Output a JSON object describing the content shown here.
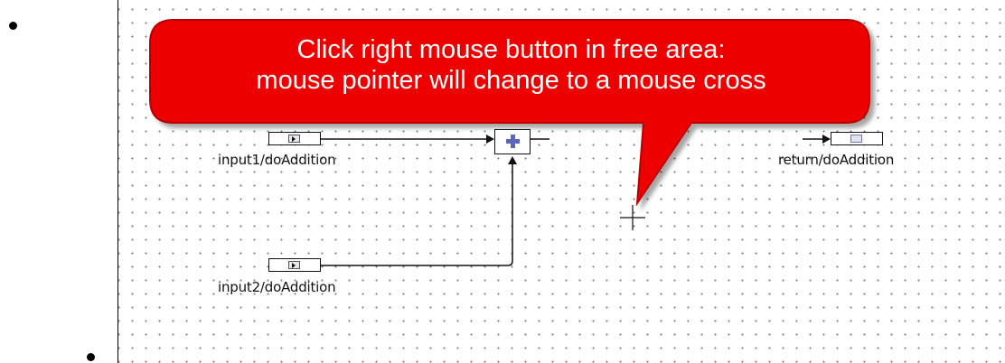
{
  "diagram": {
    "nodes": {
      "input1_label": "input1/doAddition",
      "input2_label": "input2/doAddition",
      "return_label": "return/doAddition"
    },
    "callout": {
      "text": "Click right mouse button in free area:\nmouse pointer will change to a mouse cross"
    },
    "colors": {
      "callout_fill": "#ee0000",
      "callout_border": "#b80000",
      "add_symbol": "#5a66b8",
      "grid_dot": "#7a7a7a"
    },
    "icons": [
      "input-port-arrow-icon",
      "add-operator-icon",
      "output-port-icon",
      "crosshair-cursor-icon"
    ]
  }
}
